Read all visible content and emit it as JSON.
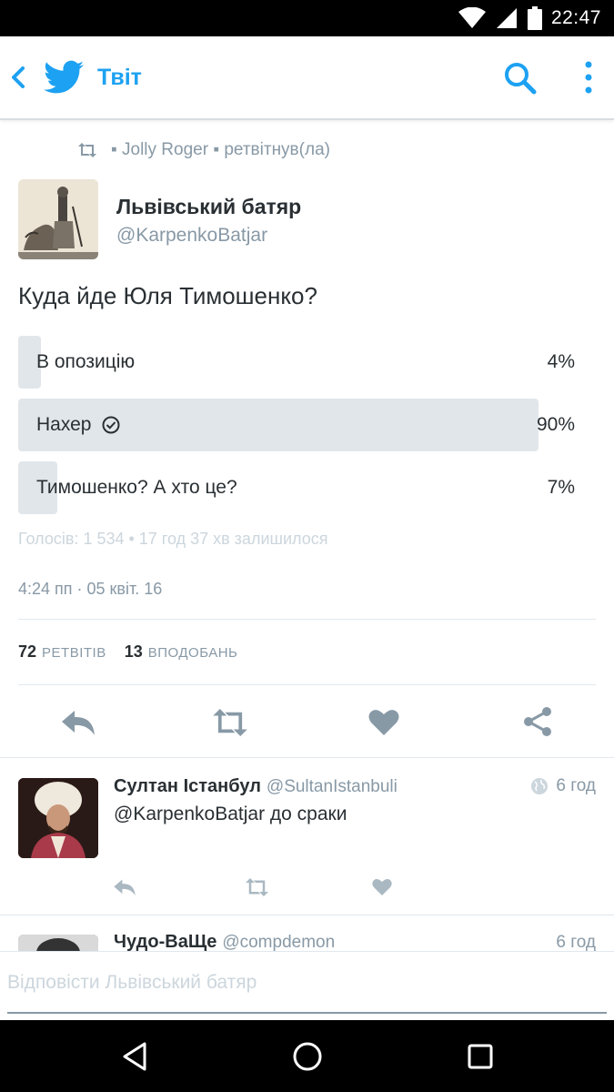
{
  "status_bar": {
    "time": "22:47"
  },
  "app_bar": {
    "title": "Твіт"
  },
  "retweet_context": {
    "text": "▪ Jolly Roger ▪ ретвітнув(ла)"
  },
  "tweet": {
    "author_name": "Львівський батяр",
    "author_handle": "@KarpenkoBatjar",
    "text": "Куда йде Юля Тимошенко?",
    "poll": {
      "options": [
        {
          "label": "В опозицію",
          "percent": "4%",
          "fill_percent": 4,
          "chosen": false
        },
        {
          "label": "Нахер",
          "percent": "90%",
          "fill_percent": 93,
          "chosen": true
        },
        {
          "label": "Тимошенко? А хто це?",
          "percent": "7%",
          "fill_percent": 7,
          "chosen": false
        }
      ],
      "meta": "Голосів: 1 534 • 17 год 37 хв залишилося"
    },
    "timestamp": "4:24 пп · 05 квіт. 16",
    "retweets_count": "72",
    "retweets_label": "РЕТВІТІВ",
    "likes_count": "13",
    "likes_label": "ВПОДОБАНЬ",
    "actions": [
      "reply-icon",
      "retweet-icon",
      "heart-icon",
      "share-icon"
    ]
  },
  "replies": [
    {
      "name": "Султан Істанбул",
      "handle": "@SultanIstanbuli",
      "time": "6 год",
      "text": "@KarpenkoBatjar до сраки",
      "actions": [
        "reply-icon",
        "retweet-icon",
        "heart-icon"
      ]
    },
    {
      "name": "Чудо-ВаЩе",
      "handle": "@compdemon",
      "time": "6 год"
    }
  ],
  "compose": {
    "placeholder": "Відповісти Львівський батяр"
  },
  "colors": {
    "accent": "#1da1f2",
    "icon_gray": "#8899a6",
    "poll_fill": "#e1e6ea"
  }
}
